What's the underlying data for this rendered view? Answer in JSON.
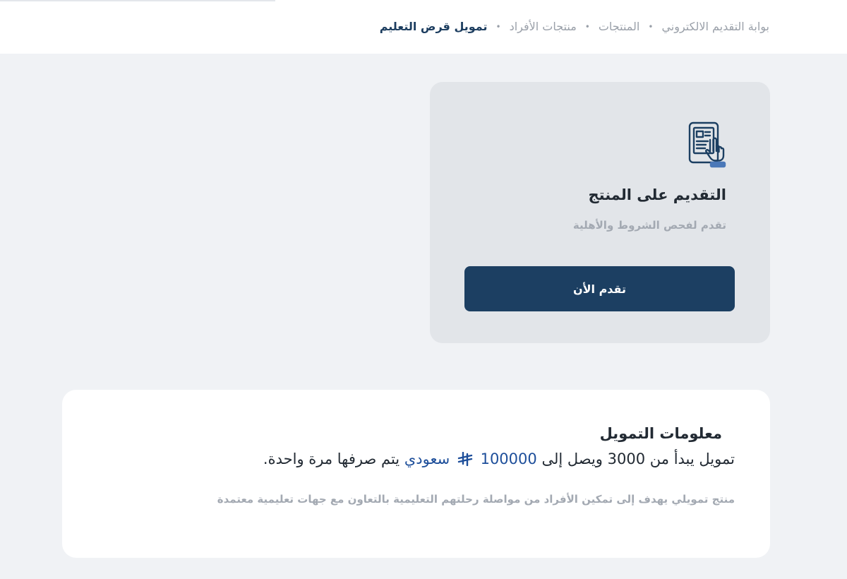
{
  "breadcrumb": {
    "items": [
      "بوابة التقديم الالكتروني",
      "المنتجات",
      "منتجات الأفراد"
    ],
    "current": "تمويل قرض التعليم",
    "separator": "•"
  },
  "apply_card": {
    "icon": "tablet-tap-icon",
    "title": "التقديم على المنتج",
    "subtitle": "تقدم لفحص الشروط والأهلية",
    "button_label": "تقدم الأن"
  },
  "financing_info": {
    "title": "معلومات التمويل",
    "range_prefix": "تمويل يبدأ من",
    "min_amount": "3000",
    "range_middle": "ويصل إلى",
    "max_amount": "100000",
    "currency_icon": "saudi-riyal-icon",
    "currency_label": "سعودي",
    "range_suffix": "يتم صرفها مرة واحدة.",
    "description": "منتج تمويلي يهدف إلى تمكين الأفراد من مواصلة رحلتهم التعليمية بالتعاون مع جهات تعليمية معتمدة"
  },
  "colors": {
    "primary": "#1c3f62",
    "highlight": "#1d4e9a",
    "page_bg": "#f0f2f5",
    "card_bg": "#e2e5e9",
    "muted_text": "#a3a9b2"
  }
}
